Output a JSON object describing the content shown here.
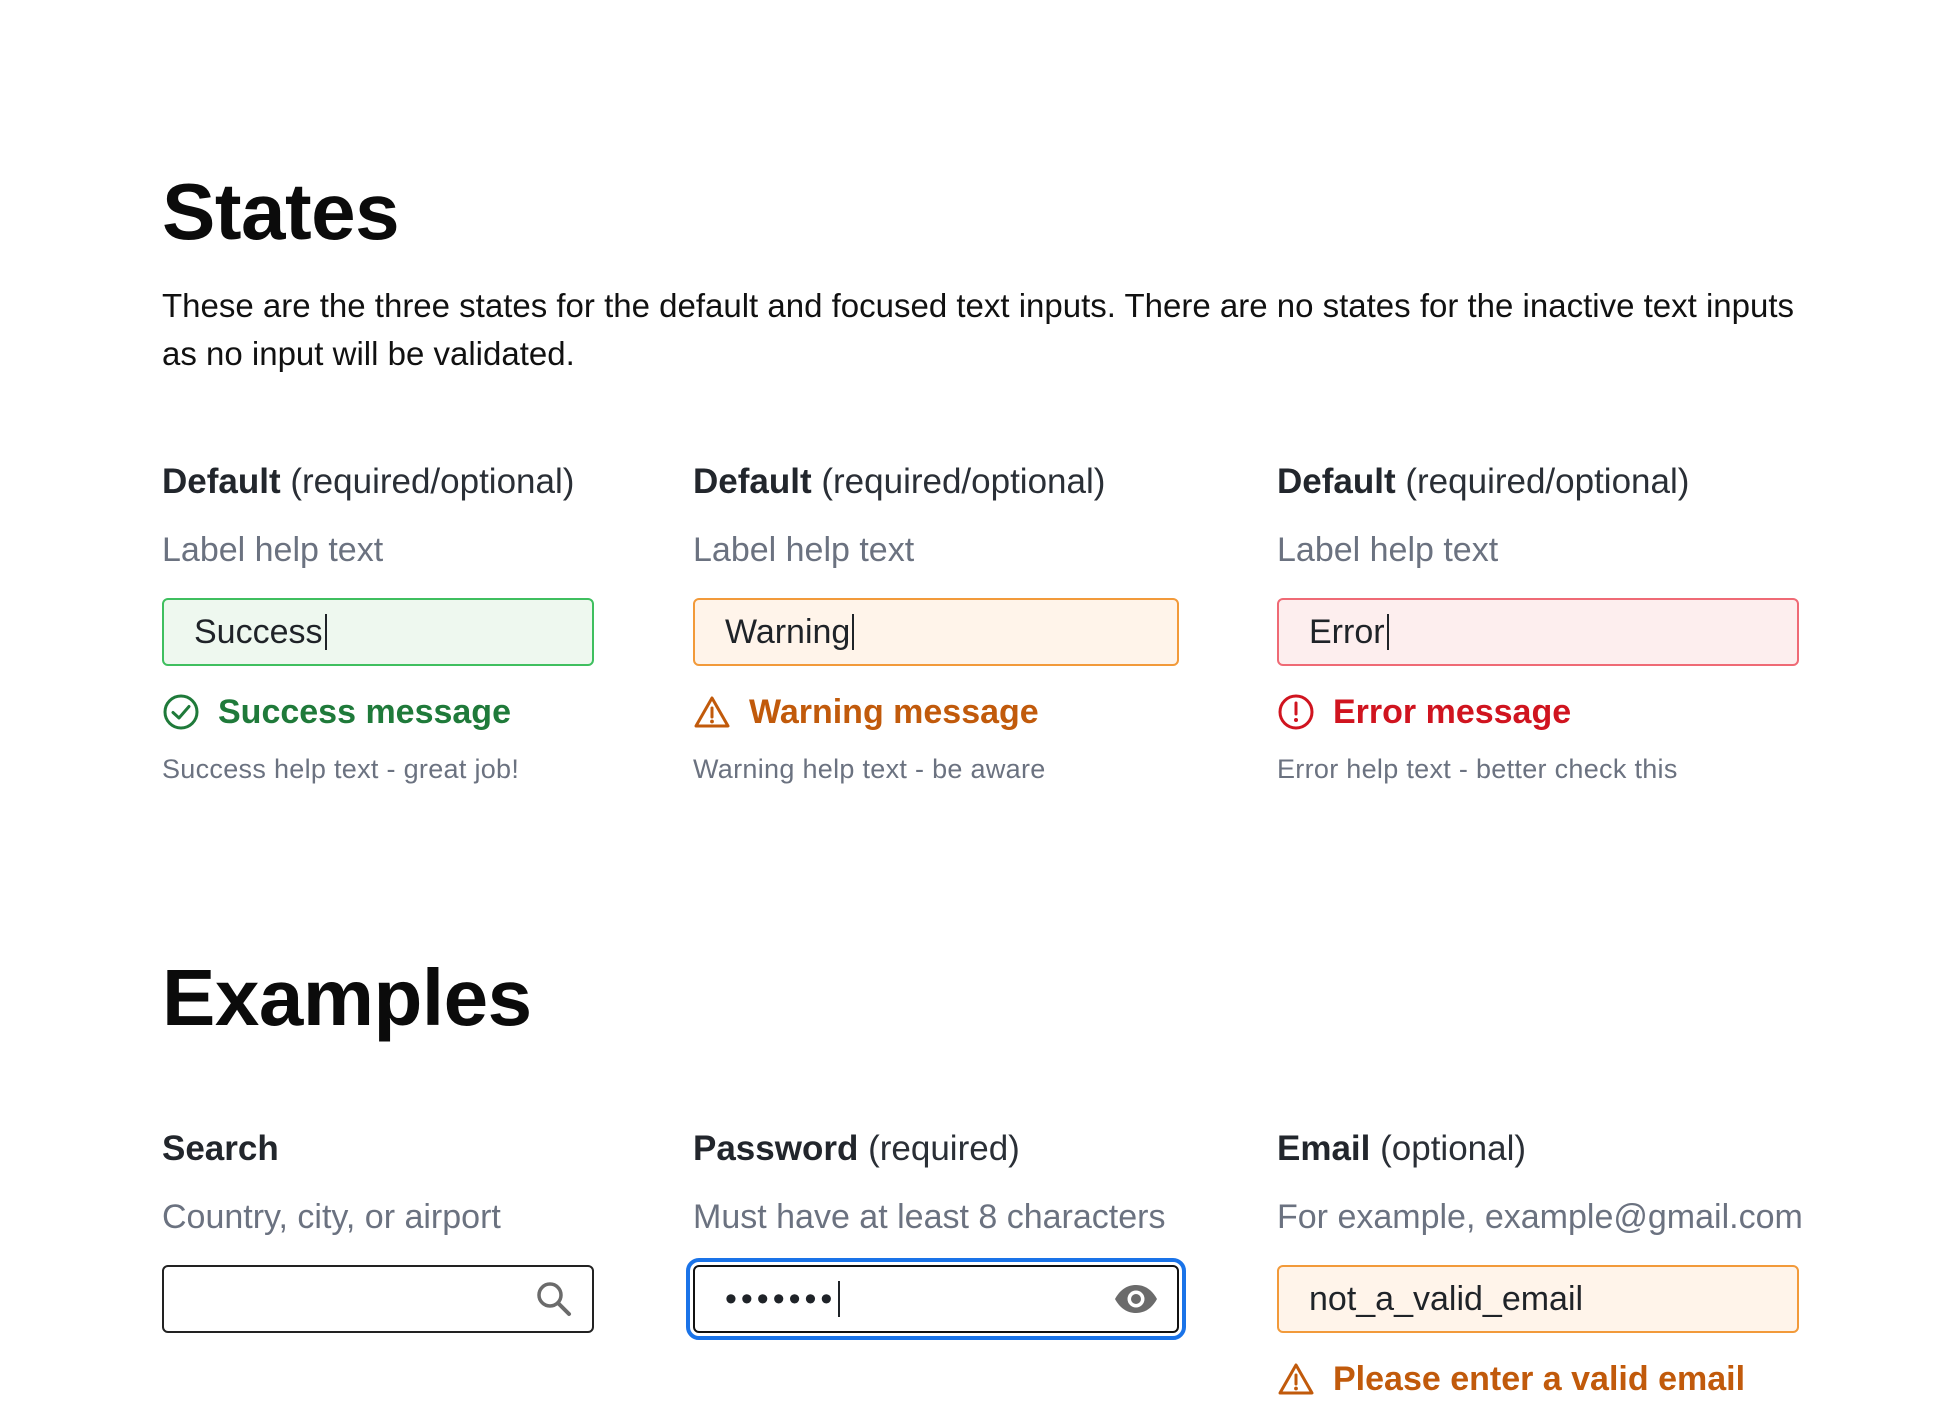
{
  "states": {
    "title": "States",
    "intro": "These are the three states for the default and focused text inputs. There are no states for the inactive text inputs as no input will be validated.",
    "fields": [
      {
        "label": "Default",
        "qualifier": "(required/optional)",
        "help": "Label help text",
        "value": "Success",
        "message": "Success message",
        "message_help": "Success help text - great job!",
        "state": "success"
      },
      {
        "label": "Default",
        "qualifier": "(required/optional)",
        "help": "Label help text",
        "value": "Warning",
        "message": "Warning message",
        "message_help": "Warning help text - be aware",
        "state": "warning"
      },
      {
        "label": "Default",
        "qualifier": "(required/optional)",
        "help": "Label help text",
        "value": "Error",
        "message": "Error message",
        "message_help": "Error help text - better check this",
        "state": "error"
      }
    ]
  },
  "examples": {
    "title": "Examples",
    "search": {
      "label": "Search",
      "help": "Country, city, or airport",
      "value": "",
      "icon": "search-icon"
    },
    "password": {
      "label": "Password",
      "qualifier": "(required)",
      "help": "Must have at least 8 characters",
      "value": "•••••••",
      "icon": "eye-icon"
    },
    "email": {
      "label": "Email",
      "qualifier": "(optional)",
      "help": "For example, example@gmail.com",
      "value": "not_a_valid_email",
      "message": "Please enter a valid email"
    }
  },
  "colors": {
    "success": "#1f7a3a",
    "warning": "#c15a0b",
    "error": "#d0141f",
    "focus": "#1a73e8"
  }
}
